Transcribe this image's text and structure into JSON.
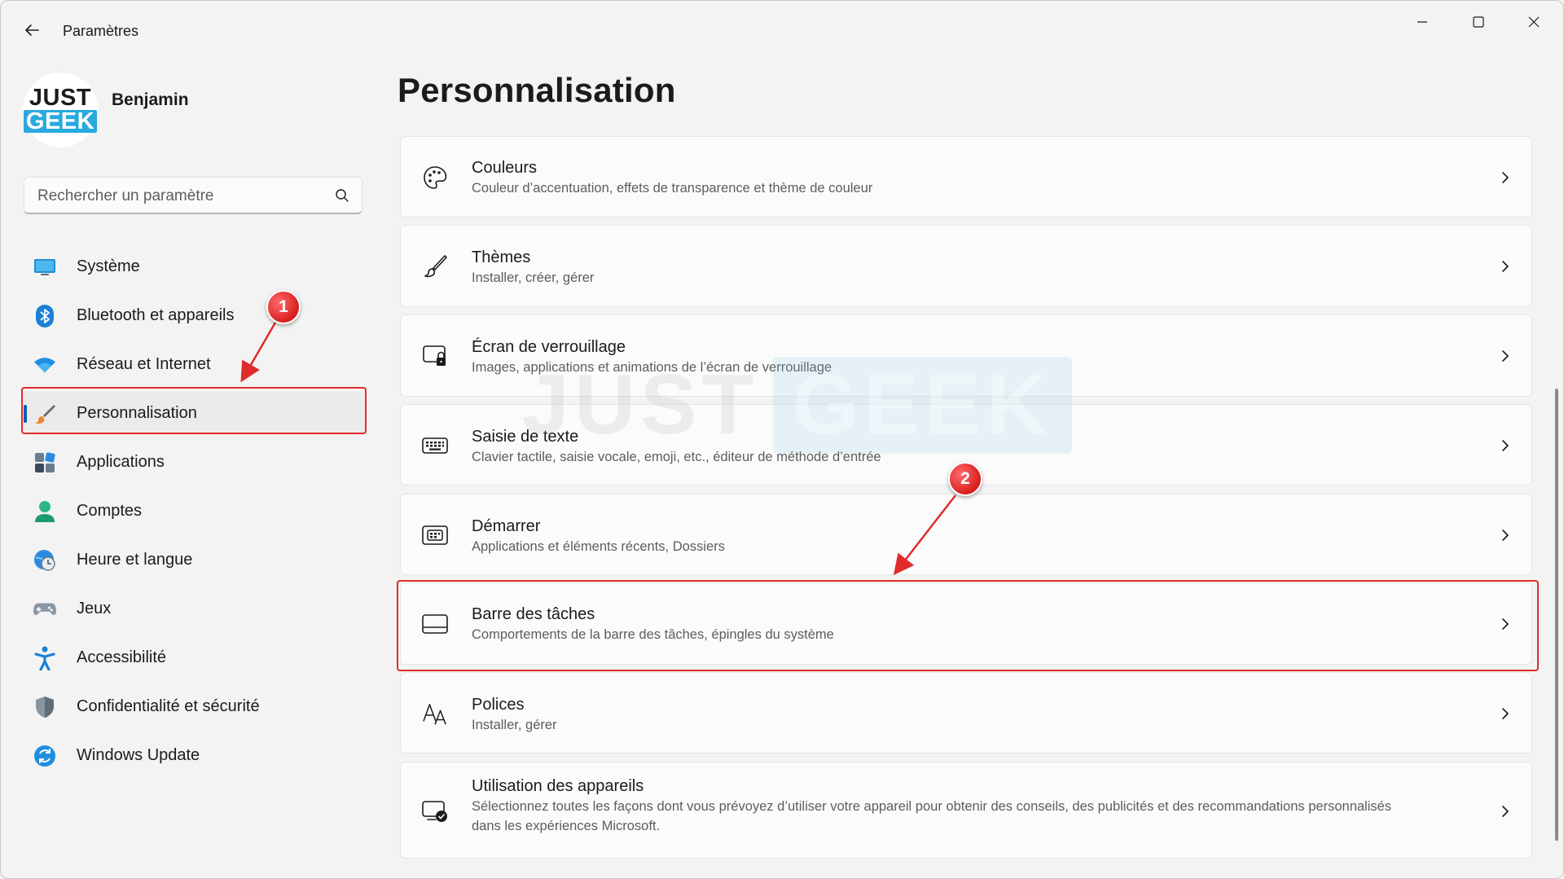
{
  "app": {
    "title": "Paramètres"
  },
  "profile": {
    "name": "Benjamin",
    "logo_line1": "JUST",
    "logo_line2": "GEEK"
  },
  "search": {
    "placeholder": "Rechercher un paramètre",
    "value": ""
  },
  "sidebar": {
    "items": [
      {
        "label": "Système",
        "icon": "system-icon",
        "active": false
      },
      {
        "label": "Bluetooth et appareils",
        "icon": "bluetooth-icon",
        "active": false
      },
      {
        "label": "Réseau et Internet",
        "icon": "wifi-icon",
        "active": false
      },
      {
        "label": "Personnalisation",
        "icon": "brush-icon",
        "active": true
      },
      {
        "label": "Applications",
        "icon": "apps-icon",
        "active": false
      },
      {
        "label": "Comptes",
        "icon": "person-icon",
        "active": false
      },
      {
        "label": "Heure et langue",
        "icon": "globe-clock-icon",
        "active": false
      },
      {
        "label": "Jeux",
        "icon": "gamepad-icon",
        "active": false
      },
      {
        "label": "Accessibilité",
        "icon": "accessibility-icon",
        "active": false
      },
      {
        "label": "Confidentialité et sécurité",
        "icon": "shield-icon",
        "active": false
      },
      {
        "label": "Windows Update",
        "icon": "update-icon",
        "active": false
      }
    ]
  },
  "main": {
    "title": "Personnalisation",
    "cards": [
      {
        "title": "Couleurs",
        "desc": "Couleur d’accentuation, effets de transparence et thème de couleur",
        "icon": "palette-icon"
      },
      {
        "title": "Thèmes",
        "desc": "Installer, créer, gérer",
        "icon": "brush-icon"
      },
      {
        "title": "Écran de verrouillage",
        "desc": "Images, applications et animations de l’écran de verrouillage",
        "icon": "lock-screen-icon"
      },
      {
        "title": "Saisie de texte",
        "desc": "Clavier tactile, saisie vocale, emoji, etc., éditeur de méthode d’entrée",
        "icon": "keyboard-icon"
      },
      {
        "title": "Démarrer",
        "desc": "Applications et éléments récents, Dossiers",
        "icon": "start-icon"
      },
      {
        "title": "Barre des tâches",
        "desc": "Comportements de la barre des tâches, épingles du système",
        "icon": "taskbar-icon"
      },
      {
        "title": "Polices",
        "desc": "Installer, gérer",
        "icon": "fonts-icon"
      },
      {
        "title": "Utilisation des appareils",
        "desc": "Sélectionnez toutes les façons dont vous prévoyez d’utiliser votre appareil pour obtenir des conseils, des publicités et des recommandations personnalisés dans les expériences Microsoft.",
        "icon": "device-usage-icon"
      }
    ]
  },
  "annotations": {
    "badge1": "1",
    "badge2": "2",
    "color": "#e12b2b"
  },
  "watermark": {
    "just": "JUST",
    "geek": "GEEK"
  },
  "colors": {
    "accent": "#005fb8",
    "background": "#f3f3f3",
    "card": "#fbfbfb",
    "annotation": "#e12b2b"
  }
}
